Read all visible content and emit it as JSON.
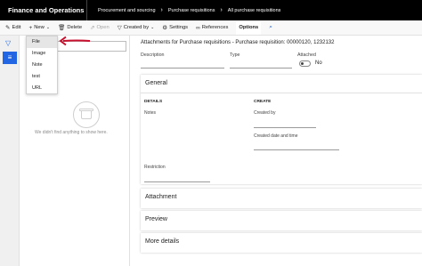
{
  "app": {
    "title": "Finance and Operations"
  },
  "breadcrumbs": [
    "Procurement and sourcing",
    "Purchase requisitions",
    "All purchase requisitions"
  ],
  "actionbar": {
    "edit": "Edit",
    "new": "New",
    "delete": "Delete",
    "open": "Open",
    "created_by": "Created by",
    "settings": "Settings",
    "references": "References",
    "options": "Options"
  },
  "new_menu": {
    "items": [
      "File",
      "Image",
      "Note",
      "test",
      "URL"
    ]
  },
  "list": {
    "empty_text": "We didn't find anything to show here."
  },
  "main": {
    "heading": "Attachments for Purchase requisitions - Purchase requisition: 00000120, 1232132",
    "description_label": "Description",
    "type_label": "Type",
    "attached_label": "Attached",
    "attached_value": "No"
  },
  "general": {
    "title": "General",
    "details_header": "DETAILS",
    "create_header": "CREATE",
    "notes_label": "Notes",
    "created_by_label": "Created by",
    "created_date_label": "Created date and time",
    "restriction_label": "Restriction"
  },
  "sections": {
    "attachment": "Attachment",
    "preview": "Preview",
    "more_details": "More details"
  },
  "colors": {
    "accent": "#2266e3",
    "arrow": "#c8102e",
    "topbar": "#000000"
  },
  "icons": {
    "edit": "pencil-icon",
    "new": "plus-icon",
    "delete": "trash-icon",
    "open": "open-icon",
    "created_by": "filter-icon",
    "settings": "gear-icon",
    "references": "link-icon",
    "search": "search-icon"
  }
}
